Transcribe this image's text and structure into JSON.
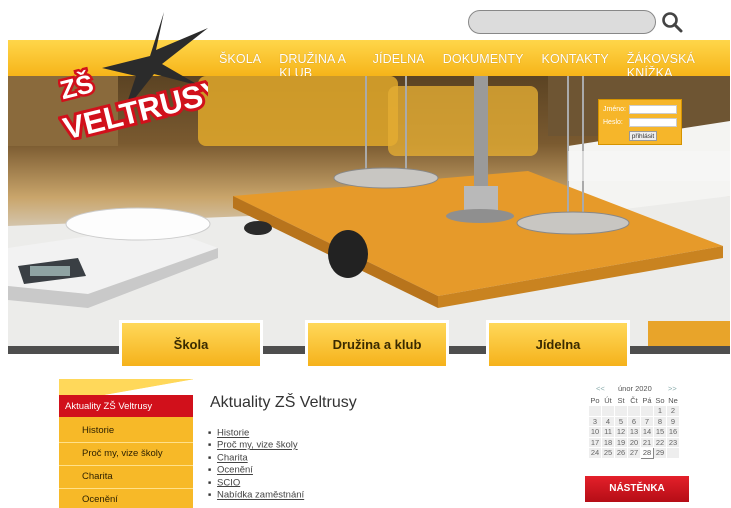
{
  "search": {
    "placeholder": ""
  },
  "logo": {
    "line1": "ZŠ",
    "line2": "VELTRUSY"
  },
  "nav": [
    "ŠKOLA",
    "DRUŽINA A KLUB",
    "JÍDELNA",
    "DOKUMENTY",
    "KONTAKTY",
    "ŽÁKOVSKÁ KNÍŽKA"
  ],
  "login": {
    "name_label": "Jméno:",
    "pass_label": "Heslo:",
    "button": "přihlásit"
  },
  "tabs": [
    "Škola",
    "Družina a klub",
    "Jídelna"
  ],
  "sidebar": {
    "active": "Aktuality ZŠ Veltrusy",
    "items": [
      "Historie",
      "Proč my, vize školy",
      "Charita",
      "Ocenění"
    ]
  },
  "content": {
    "title": "Aktuality ZŠ Veltrusy",
    "links": [
      "Historie",
      "Proč my, vize školy",
      "Charita",
      "Ocenění",
      "SCIO",
      "Nabídka zaměstnání"
    ]
  },
  "calendar": {
    "prev": "<<",
    "next": ">>",
    "month": "únor 2020",
    "weekdays": [
      "Po",
      "Út",
      "St",
      "Čt",
      "Pá",
      "So",
      "Ne"
    ],
    "weeks": [
      [
        "",
        "",
        "",
        "",
        "",
        "1",
        "2"
      ],
      [
        "3",
        "4",
        "5",
        "6",
        "7",
        "8",
        "9"
      ],
      [
        "10",
        "11",
        "12",
        "13",
        "14",
        "15",
        "16"
      ],
      [
        "17",
        "18",
        "19",
        "20",
        "21",
        "22",
        "23"
      ],
      [
        "24",
        "25",
        "26",
        "27",
        "28",
        "29",
        ""
      ]
    ],
    "today": "28"
  },
  "nastenka": "NÁSTĚNKA",
  "colors": {
    "accent": "#f5b21b",
    "brand_red": "#d1101b"
  }
}
